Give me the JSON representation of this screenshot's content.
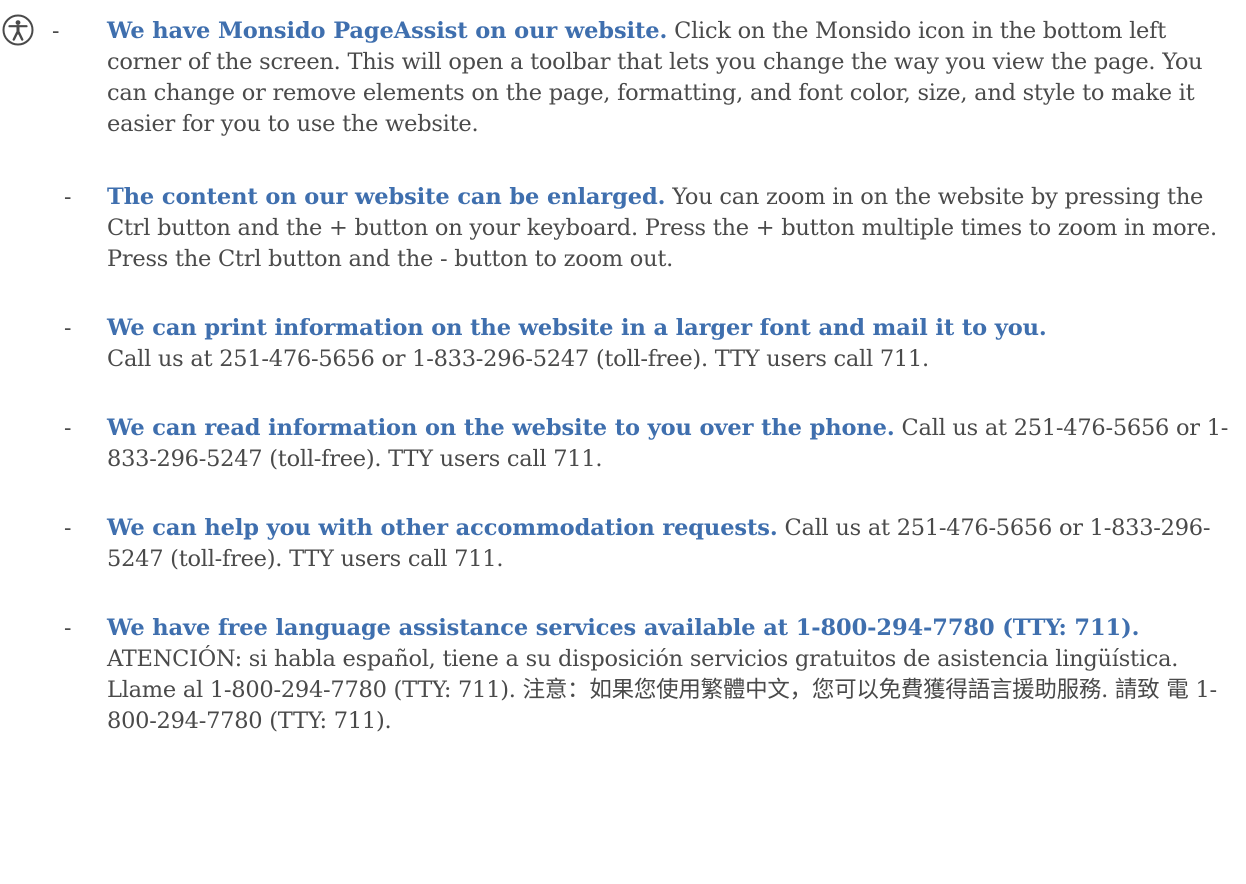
{
  "colors": {
    "heading": "#3f6fae",
    "body_text": "#4a4a4a",
    "icon": "#4a4a4a"
  },
  "icon": "accessibility-person-icon",
  "bullet_marker": "-",
  "items": [
    {
      "heading": "We have Monsido PageAssist on our website.",
      "text": " Click on the Monsido icon in the bottom left corner of the screen. This will open a toolbar that lets you change the way you view the page. You can change or remove elements on the page, formatting, and font color, size, and style to make it easier for you to use the website."
    },
    {
      "heading": "The content on our website can be enlarged.",
      "text": "  You can zoom in on the website by pressing the Ctrl button and the + button on your keyboard. Press the + button multiple times to zoom in more. Press the Ctrl button and the - button to zoom out."
    },
    {
      "heading": "We can print information on the website in a larger font and mail it to you.",
      "text": "Call us at 251-476-5656 or 1-833-296-5247 (toll-free). TTY users call 711."
    },
    {
      "heading": "We can read information on the website to you over the phone.",
      "text": " Call us at 251-476-5656 or 1-833-296-5247 (toll-free). TTY users call 711."
    },
    {
      "heading": "We can help you with other accommodation requests.",
      "text": " Call us at 251-476-5656 or 1-833-296-5247 (toll-free). TTY users call 711."
    },
    {
      "heading": "We have free language assistance services available at 1-800-294-7780 (TTY: 711).",
      "text": "ATENCIÓN: si habla español, tiene a su disposición servicios gratuitos de asistencia lingüística. Llame al 1-800-294-7780 (TTY: 711). 注意：如果您使用繁體中文，您可以免費獲得語言援助服務. 請致 電 1-800-294-7780 (TTY: 711)."
    }
  ]
}
